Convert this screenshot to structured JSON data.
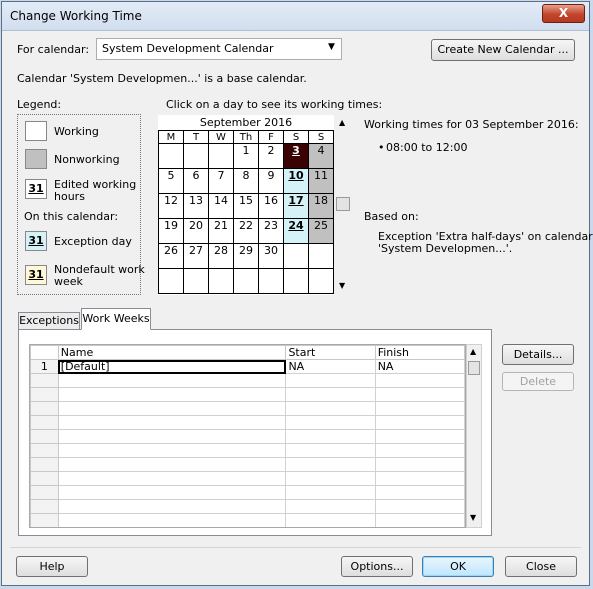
{
  "window": {
    "title": "Change Working Time",
    "close_glyph": "X"
  },
  "for_calendar": {
    "label": "For calendar:",
    "value": "System Development Calendar",
    "create_button": "Create New Calendar ..."
  },
  "base_note": "Calendar 'System Developmen...' is a base calendar.",
  "legend": {
    "heading": "Legend:",
    "working": "Working",
    "nonworking": "Nonworking",
    "edited_line1": "Edited working",
    "edited_line2": "hours",
    "on_this_calendar": "On this calendar:",
    "exception": "Exception day",
    "nondefault_line1": "Nondefault work",
    "nondefault_line2": "week",
    "sample_number": "31"
  },
  "calendar": {
    "instruction": "Click on a day to see its working times:",
    "month": "September 2016",
    "weekdays": [
      "M",
      "T",
      "W",
      "Th",
      "F",
      "S",
      "S"
    ],
    "weeks": [
      [
        "",
        "",
        "",
        "1",
        "2",
        "3",
        "4"
      ],
      [
        "5",
        "6",
        "7",
        "8",
        "9",
        "10",
        "11"
      ],
      [
        "12",
        "13",
        "14",
        "15",
        "16",
        "17",
        "18"
      ],
      [
        "19",
        "20",
        "21",
        "22",
        "23",
        "24",
        "25"
      ],
      [
        "26",
        "27",
        "28",
        "29",
        "30",
        "",
        ""
      ],
      [
        "",
        "",
        "",
        "",
        "",
        "",
        ""
      ]
    ]
  },
  "working_times": {
    "heading": "Working times for 03 September 2016:",
    "bullet": "•",
    "time": "08:00 to 12:00",
    "based_on_label": "Based on:",
    "based_on_line1": "Exception 'Extra half-days' on calendar",
    "based_on_line2": "'System Developmen...'."
  },
  "tabs": [
    {
      "label": "Exceptions",
      "active": false
    },
    {
      "label": "Work Weeks",
      "active": true
    }
  ],
  "grid": {
    "columns": [
      "Name",
      "Start",
      "Finish"
    ],
    "rows": [
      {
        "id": "1",
        "name": "[Default]",
        "start": "NA",
        "finish": "NA"
      }
    ],
    "details_button": "Details...",
    "delete_button": "Delete"
  },
  "footer": {
    "help": "Help",
    "options": "Options...",
    "ok": "OK",
    "close": "Close"
  }
}
